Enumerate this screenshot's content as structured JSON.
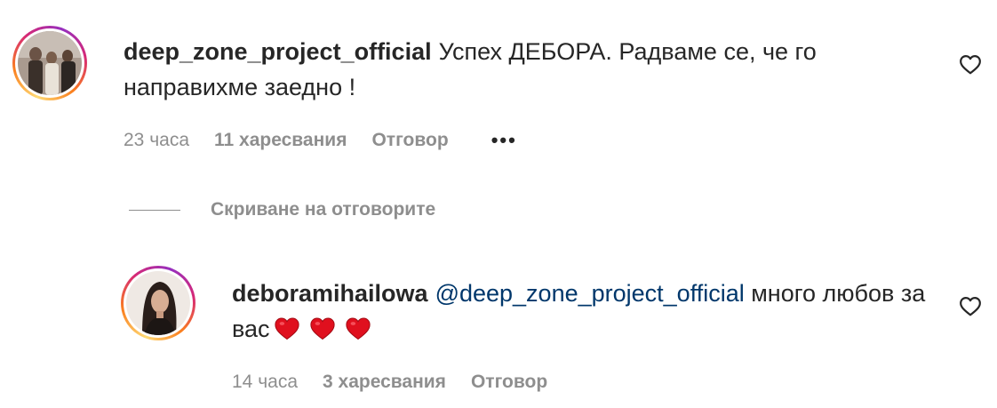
{
  "comment": {
    "username": "deep_zone_project_official",
    "text": "Успех ДЕБОРА. Радваме се, че го направихме заедно !",
    "time": "23 часа",
    "likes": "11 харесвания",
    "reply_label": "Отговор",
    "more_label": "•••"
  },
  "hide_replies_label": "Скриване на отговорите",
  "reply": {
    "username": "deboramihailowa",
    "mention": "@deep_zone_project_official",
    "text": "много любов за вас",
    "emojis": [
      "red-heart",
      "red-heart",
      "red-heart"
    ],
    "time": "14 часа",
    "likes": "3 харесвания",
    "reply_label": "Отговор"
  },
  "colors": {
    "text": "#262626",
    "secondary": "#8e8e8e",
    "mention": "#00376b",
    "heart_emoji": "#e0101e"
  }
}
